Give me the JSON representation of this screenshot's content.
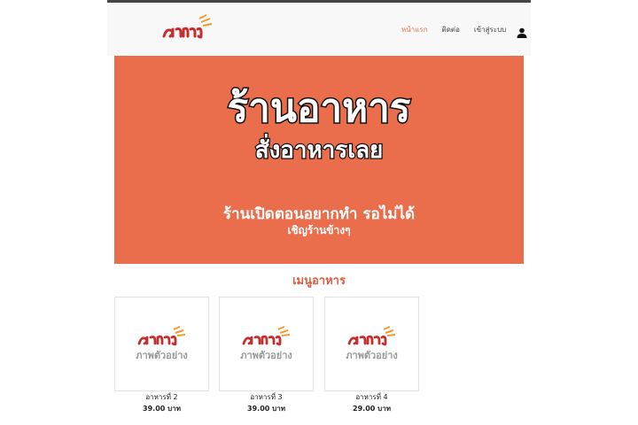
{
  "nav": {
    "brand_icon": "aharn-logo",
    "links": [
      {
        "label": "หน้าแรก",
        "active": true
      },
      {
        "label": "ติดต่อ",
        "active": false
      },
      {
        "label": "เข้าสู่ระบบ",
        "active": false
      }
    ],
    "user_icon": "user-icon"
  },
  "hero": {
    "title": "ร้านอาหาร",
    "subtitle": "สั่งอาหารเลย",
    "line1": "ร้านเปิดตอนอยากทำ รอไม่ได้",
    "line2": "เชิญร้านข้างๆ",
    "background": "#eb6e4c"
  },
  "menu": {
    "heading": "เมนูอาหาร",
    "items": [
      {
        "name": "อาหารที่ 2",
        "price": "39.00 บาท",
        "image_caption": "ภาพตัวอย่าง"
      },
      {
        "name": "อาหารที่ 3",
        "price": "39.00 บาท",
        "image_caption": "ภาพตัวอย่าง"
      },
      {
        "name": "อาหารที่ 4",
        "price": "29.00 บาท",
        "image_caption": "ภาพตัวอย่าง"
      }
    ]
  },
  "colors": {
    "accent": "#e8704b",
    "logo_red": "#c62e2e",
    "logo_orange": "#f29a2e"
  }
}
